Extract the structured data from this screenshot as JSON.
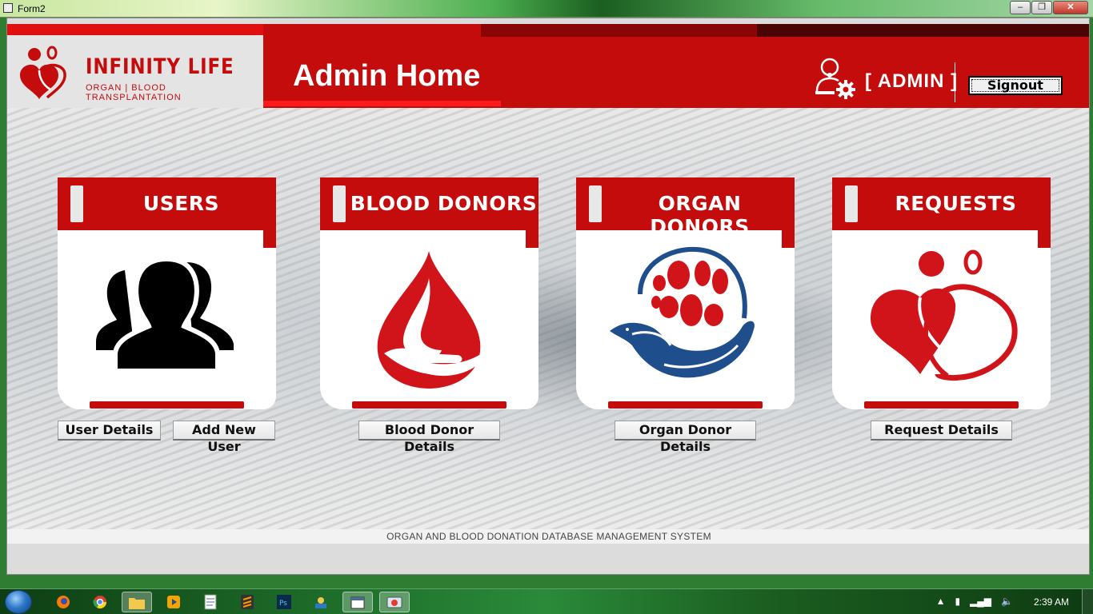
{
  "window": {
    "title": "Form2",
    "minimize": "–",
    "maximize": "❐",
    "close": "✕"
  },
  "header": {
    "brand_name": "INFINITY LIFE",
    "brand_tagline": "ORGAN | BLOOD  TRANSPLANTATION",
    "page_title": "Admin Home",
    "role_label": "[ ADMIN ]",
    "signout_label": "Signout"
  },
  "cards": [
    {
      "title": "USERS",
      "icon": "users-icon",
      "buttons": [
        "User Details",
        "Add New User"
      ]
    },
    {
      "title": "BLOOD DONORS",
      "icon": "blood-drop-hand-icon",
      "buttons": [
        "Blood Donor Details"
      ]
    },
    {
      "title": "ORGAN DONORS",
      "icon": "organ-dove-hand-icon",
      "buttons": [
        "Organ Donor Details"
      ]
    },
    {
      "title": "REQUESTS",
      "icon": "hearts-icon",
      "buttons": [
        "Request Details"
      ]
    }
  ],
  "footer": {
    "text": "ORGAN AND BLOOD DONATION DATABASE MANAGEMENT SYSTEM"
  },
  "taskbar": {
    "items": [
      "firefox-icon",
      "chrome-icon",
      "folder-icon",
      "media-player-icon",
      "notepad-icon",
      "sublime-icon",
      "photoshop-icon",
      "app-icon",
      "form-app-icon",
      "control-panel-icon"
    ],
    "clock": "2:39 AM"
  },
  "colors": {
    "brand_red": "#c40c0c",
    "bright_red": "#e01010",
    "organ_blue": "#1f4e8c",
    "taskbar_green": "#1e6d2a"
  }
}
